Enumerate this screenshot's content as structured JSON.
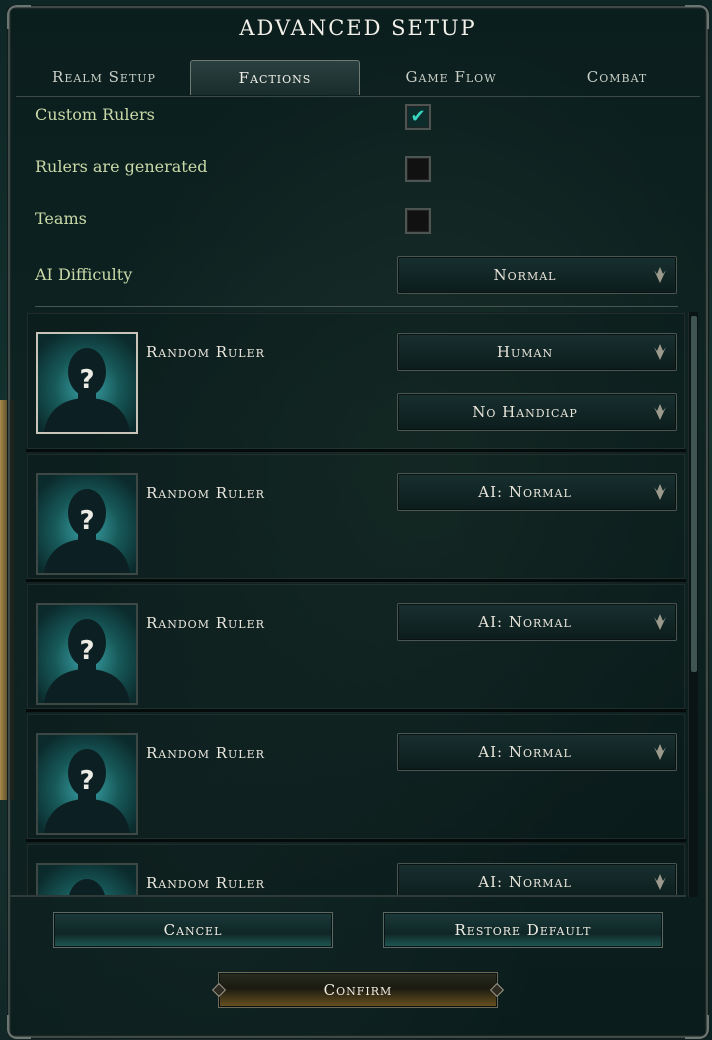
{
  "window": {
    "title": "ADVANCED SETUP"
  },
  "tabs": [
    {
      "label": "Realm Setup",
      "active": false
    },
    {
      "label": "Factions",
      "active": true
    },
    {
      "label": "Game Flow",
      "active": false
    },
    {
      "label": "Combat",
      "active": false
    }
  ],
  "options": {
    "custom_rulers": {
      "label": "Custom Rulers",
      "checked": true,
      "check_glyph": "✔"
    },
    "rulers_generated": {
      "label": "Rulers are generated",
      "checked": false
    },
    "teams": {
      "label": "Teams",
      "checked": false
    },
    "ai_difficulty": {
      "label": "AI Difficulty",
      "value": "Normal"
    }
  },
  "rulers": [
    {
      "name": "Random Ruler",
      "type": "Human",
      "handicap": "No Handicap"
    },
    {
      "name": "Random Ruler",
      "type": "AI: Normal"
    },
    {
      "name": "Random Ruler",
      "type": "AI: Normal"
    },
    {
      "name": "Random Ruler",
      "type": "AI: Normal"
    },
    {
      "name": "Random Ruler",
      "type": "AI: Normal"
    }
  ],
  "buttons": {
    "cancel": "Cancel",
    "restore_default": "Restore Default",
    "confirm": "Confirm"
  },
  "icons": {
    "dropdown": "chevron-down-icon",
    "portrait": "unknown-person-icon",
    "check": "checkmark-icon"
  },
  "colors": {
    "accent_teal": "#38d6c0",
    "label_green": "#c9d9a8",
    "text_light": "#ebe8df"
  }
}
